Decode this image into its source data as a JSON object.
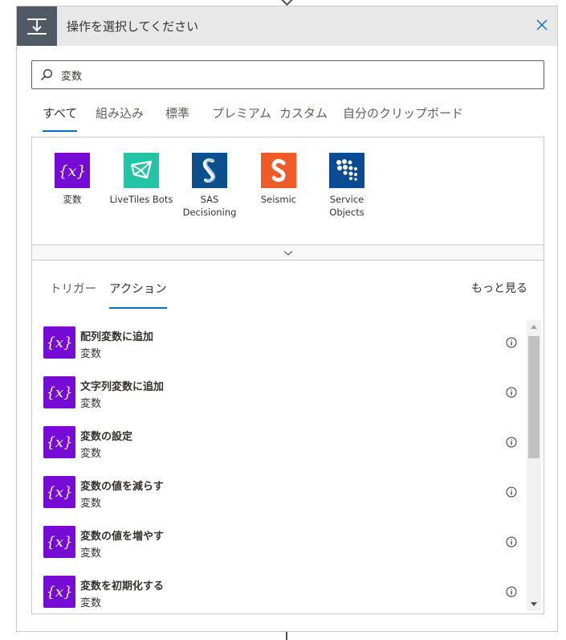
{
  "header": {
    "title": "操作を選択してください"
  },
  "search": {
    "value": "変数",
    "placeholder": ""
  },
  "tabs": [
    {
      "label": "すべて",
      "active": true
    },
    {
      "label": "組み込み",
      "active": false
    },
    {
      "label": "標準",
      "active": false
    },
    {
      "label": "プレミアム",
      "active": false
    },
    {
      "label": "カスタム",
      "active": false
    },
    {
      "label": "自分のクリップボード",
      "active": false
    }
  ],
  "connectors": [
    {
      "label": "変数",
      "icon": "variable-icon",
      "color": "#770bd6"
    },
    {
      "label": "LiveTiles Bots",
      "icon": "livetiles-bots-icon",
      "color": "#23c4a6"
    },
    {
      "label": "SAS\nDecisioning",
      "icon": "sas-icon",
      "color": "#0b4f8c"
    },
    {
      "label": "Seismic",
      "icon": "seismic-icon",
      "color": "#f05a28"
    },
    {
      "label": "Service\nObjects",
      "icon": "service-objects-icon",
      "color": "#0a4c94"
    }
  ],
  "subtabs": [
    {
      "label": "トリガー",
      "active": false
    },
    {
      "label": "アクション",
      "active": true
    }
  ],
  "see_more": "もっと見る",
  "actions": [
    {
      "title": "配列変数に追加",
      "connector": "変数"
    },
    {
      "title": "文字列変数に追加",
      "connector": "変数"
    },
    {
      "title": "変数の設定",
      "connector": "変数"
    },
    {
      "title": "変数の値を減らす",
      "connector": "変数"
    },
    {
      "title": "変数の値を増やす",
      "connector": "変数"
    },
    {
      "title": "変数を初期化する",
      "connector": "変数"
    }
  ],
  "colors": {
    "accent": "#0f6cbd",
    "variable": "#770bd6",
    "header_icon_bg": "#505a64"
  }
}
